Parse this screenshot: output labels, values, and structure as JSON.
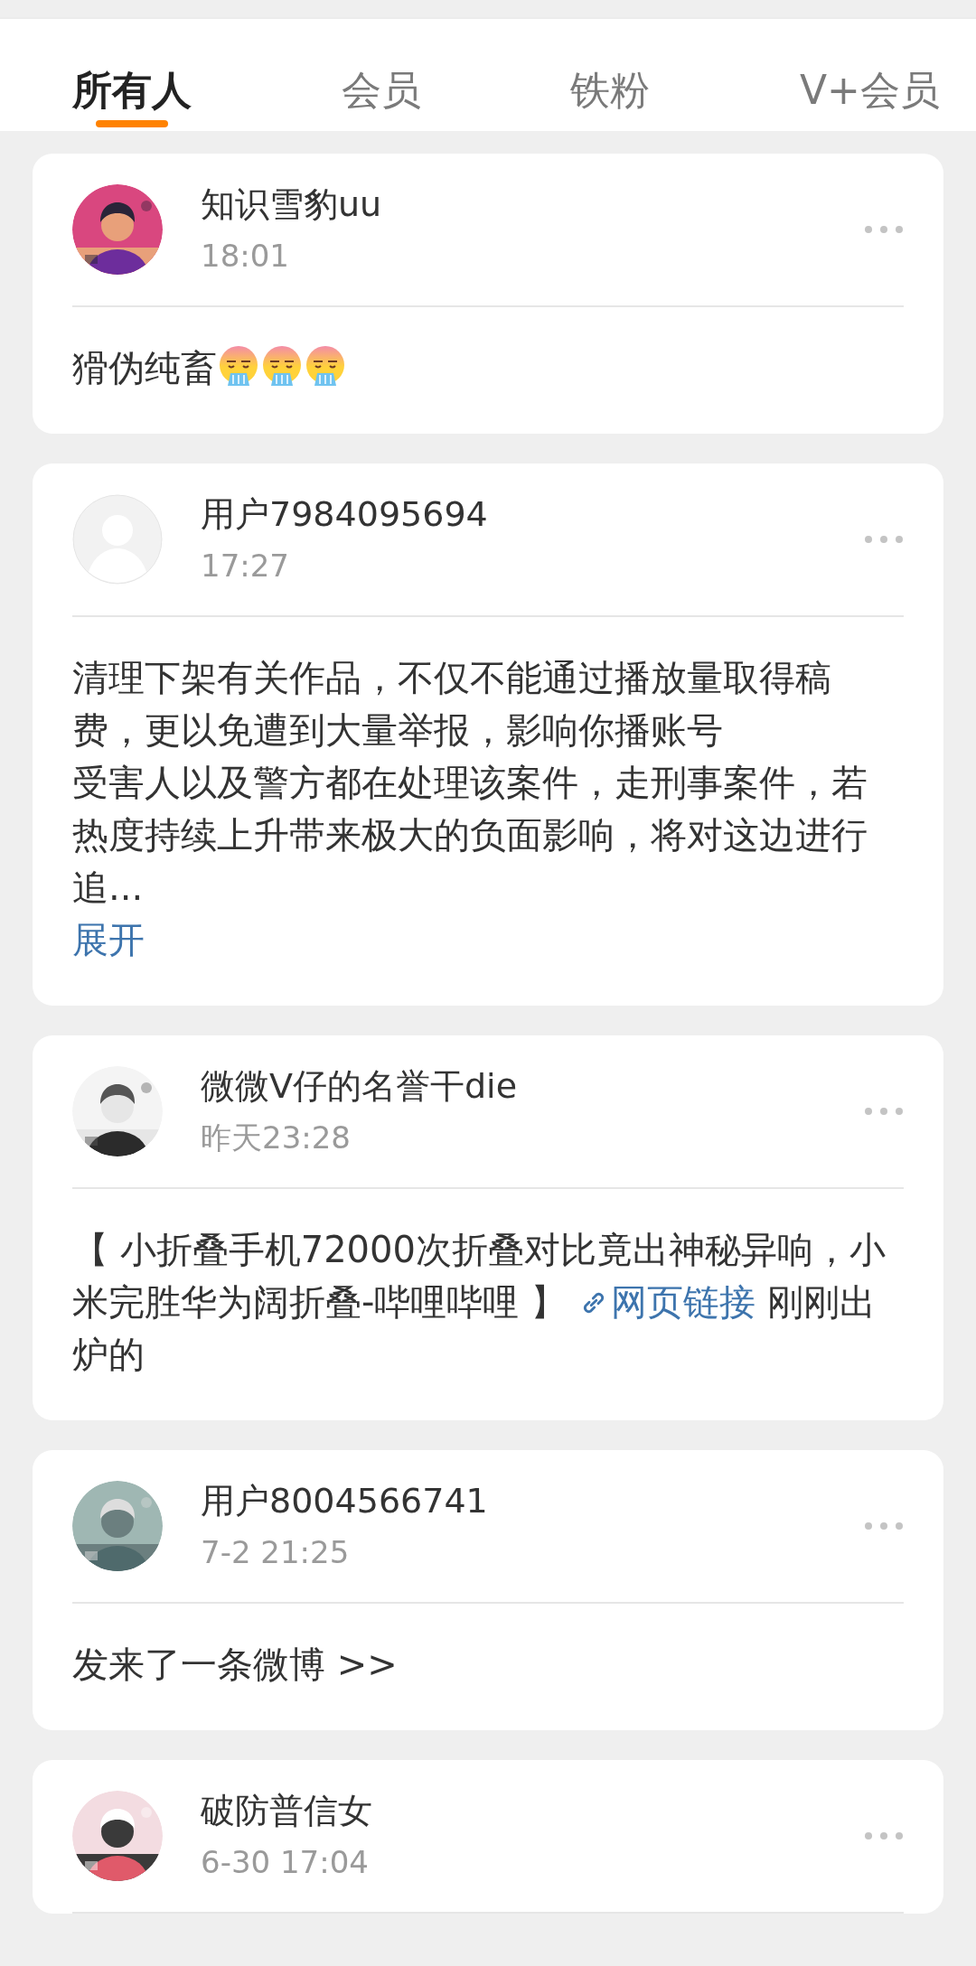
{
  "tabs": [
    {
      "label": "所有人",
      "selected": true
    },
    {
      "label": "会员",
      "selected": false
    },
    {
      "label": "铁粉",
      "selected": false
    },
    {
      "label": "V+会员",
      "selected": false
    }
  ],
  "posts": [
    {
      "author": "知识雪豹uu",
      "time": "18:01",
      "avatar": {
        "kind": "picture"
      },
      "body": [
        {
          "kind": "text",
          "text": "猾伪纯畜"
        },
        {
          "kind": "emoji"
        },
        {
          "kind": "emoji"
        },
        {
          "kind": "emoji"
        }
      ]
    },
    {
      "author": "用户7984095694",
      "time": "17:27",
      "avatar": {
        "kind": "default"
      },
      "body": [
        {
          "kind": "text",
          "text": "清理下架有关作品，不仅不能通过播放量取得稿费，更以免遭到大量举报，影响你播账号"
        },
        {
          "kind": "line",
          "text": "受害人以及警方都在处理该案件，走刑事案件，若热度持续上升带来极大的负面影响，将对这边进行追..."
        },
        {
          "kind": "expand",
          "text": "展开"
        }
      ]
    },
    {
      "author": "微微V仔的名誉干die",
      "time": "昨天23:28",
      "avatar": {
        "kind": "picture"
      },
      "body": [
        {
          "kind": "text",
          "text": "【 小折叠手机72000次折叠对比竟出神秘异响，小米完胜华为阔折叠-哔哩哔哩 】 "
        },
        {
          "kind": "link",
          "text": "网页链接"
        },
        {
          "kind": "text",
          "text": " 刚刚出炉的"
        }
      ]
    },
    {
      "author": "用户8004566741",
      "time": "7-2 21:25",
      "avatar": {
        "kind": "picture"
      },
      "body": [
        {
          "kind": "text",
          "text": "发来了一条微博 >>"
        }
      ]
    },
    {
      "author": "破防普信女",
      "time": "6-30 17:04",
      "avatar": {
        "kind": "picture"
      }
    }
  ]
}
